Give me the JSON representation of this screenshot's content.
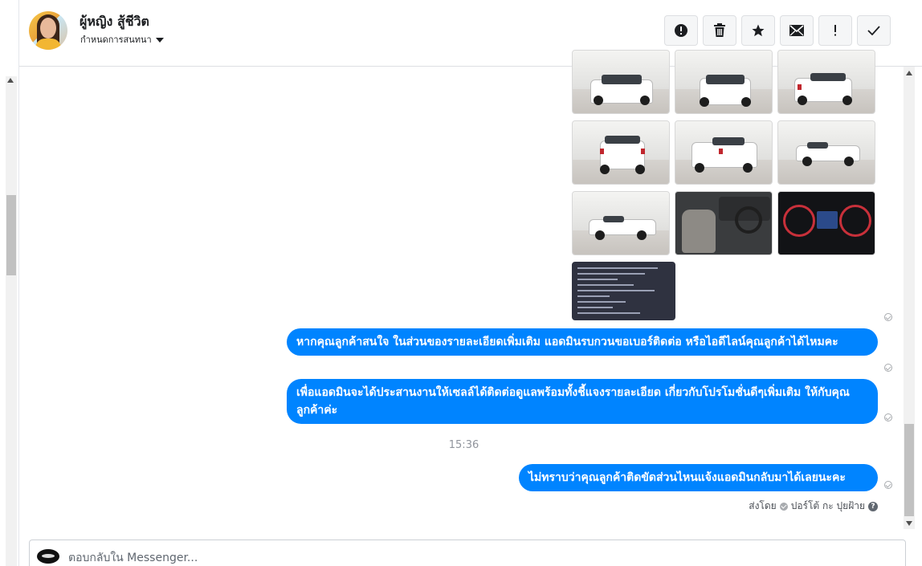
{
  "header": {
    "contact_name": "ผู้หญิง สู้ชีวิต",
    "assign_label": "กำหนดการสนทนา",
    "actions": [
      {
        "name": "spam-alert-button",
        "icon": "alert-circle-icon"
      },
      {
        "name": "delete-button",
        "icon": "trash-icon"
      },
      {
        "name": "star-button",
        "icon": "star-icon"
      },
      {
        "name": "mark-unread-button",
        "icon": "envelope-icon"
      },
      {
        "name": "follow-up-button",
        "icon": "exclamation-icon"
      },
      {
        "name": "done-button",
        "icon": "check-icon"
      }
    ]
  },
  "messages": [
    {
      "text": "หากคุณลูกค้าสนใจ ในส่วนของรายละเอียดเพิ่มเติม แอดมินรบกวนขอเบอร์ติดต่อ หรือไอดีไลน์คุณลูกค้าได้ไหมคะ"
    },
    {
      "text": "เพื่อแอดมินจะได้ประสานงานให้เซลล์ได้ติดต่อดูแลพร้อมทั้งชี้แจงรายละเอียด เกี่ยวกับโปรโมชั่นดีๆเพิ่มเติม ให้กับคุณลูกค้าค่ะ"
    },
    {
      "text": "ไม่ทราบว่าคุณลูกค้าติดขัดส่วนไหนแจ้งแอดมินกลับมาได้เลยนะคะ"
    }
  ],
  "timestamp": "15:36",
  "sent_by": {
    "prefix": "ส่งโดย",
    "name": "ปอร์โต้ กะ ปุยฝ้าย"
  },
  "composer": {
    "placeholder": "ตอบกลับใน Messenger..."
  },
  "colors": {
    "bubble": "#0084ff",
    "header_border": "#dddfe2",
    "muted_text": "#90949c"
  }
}
